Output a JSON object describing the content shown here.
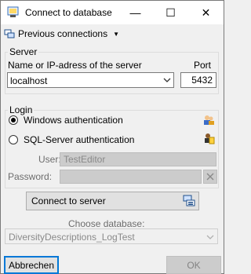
{
  "window": {
    "title": "Connect to database",
    "minimize_glyph": "—",
    "maximize_glyph": "☐",
    "close_glyph": "✕"
  },
  "menu": {
    "previous_connections": "Previous connections"
  },
  "server": {
    "group_label": "Server",
    "name_label": "Name or IP-adress of the server",
    "name_value": "localhost",
    "port_label": "Port",
    "port_value": "5432"
  },
  "login": {
    "group_label": "Login",
    "windows_auth": "Windows authentication",
    "sql_auth": "SQL-Server authentication",
    "selected": "windows",
    "user_label": "User:",
    "user_value": "TestEditor",
    "password_label": "Password:",
    "password_value": ""
  },
  "connect_button": "Connect to server",
  "database": {
    "label": "Choose database:",
    "selected": "DiversityDescriptions_LogTest"
  },
  "footer": {
    "cancel": "Abbrechen",
    "ok": "OK"
  },
  "colors": {
    "accent": "#0078d7",
    "disabled_fill": "#cccccc"
  }
}
